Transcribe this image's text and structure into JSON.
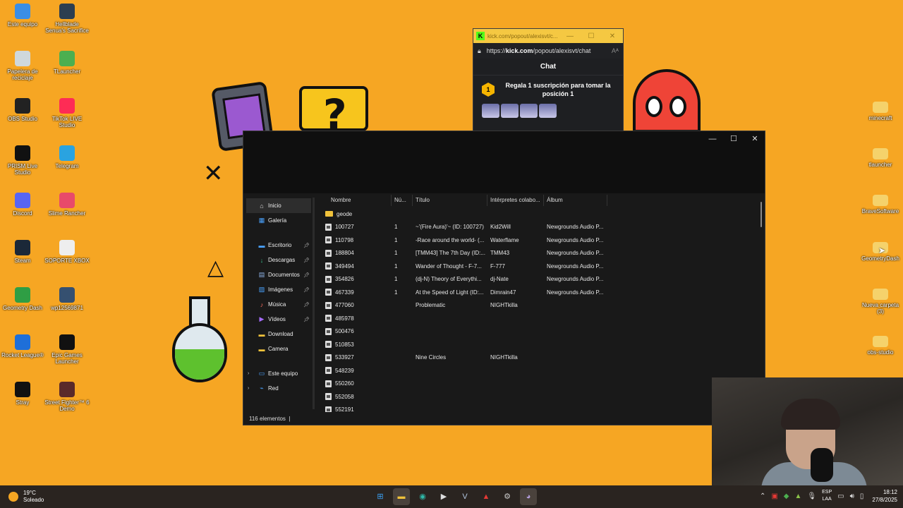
{
  "desktop": {
    "left_icons": [
      {
        "label": "Este equipo",
        "icon": "computer-icon",
        "color": "#3a8ee6"
      },
      {
        "label": "Hellblade Senua's Sacrifice",
        "icon": "game-icon",
        "color": "#2c3e50"
      },
      {
        "label": "Papelera de reciclaje",
        "icon": "recycle-bin-icon",
        "color": "#cfd8dc"
      },
      {
        "label": "TLauncher",
        "icon": "minecraft-icon",
        "color": "#4caf50"
      },
      {
        "label": "OBS Studio",
        "icon": "obs-icon",
        "color": "#222"
      },
      {
        "label": "TikTok LIVE Studio",
        "icon": "tiktok-icon",
        "color": "#fe2c55"
      },
      {
        "label": "PRISM Live Studio",
        "icon": "prism-icon",
        "color": "#111"
      },
      {
        "label": "Telegram",
        "icon": "telegram-icon",
        "color": "#2aa3e0"
      },
      {
        "label": "Discord",
        "icon": "discord-icon",
        "color": "#5865f2"
      },
      {
        "label": "Slime Rancher",
        "icon": "slime-icon",
        "color": "#e84a6a"
      },
      {
        "label": "Steam",
        "icon": "steam-icon",
        "color": "#1b2838"
      },
      {
        "label": "SOPORTE XBOX",
        "icon": "file-icon",
        "color": "#eeeeee"
      },
      {
        "label": "Geometry Dash",
        "icon": "geometry-dash-icon",
        "color": "#2f9e44"
      },
      {
        "label": "wp12569871",
        "icon": "image-icon",
        "color": "#355070"
      },
      {
        "label": "Rocket League®",
        "icon": "rocket-league-icon",
        "color": "#1e6fd9"
      },
      {
        "label": "Epic Games Launcher",
        "icon": "epic-icon",
        "color": "#111"
      },
      {
        "label": "Stray",
        "icon": "stray-icon",
        "color": "#111"
      },
      {
        "label": "Street Fighter™ 6 Demo",
        "icon": "street-fighter-icon",
        "color": "#5a2a2a"
      }
    ],
    "right_icons": [
      {
        "label": "minecraft",
        "icon": "folder-icon"
      },
      {
        "label": "tlauncher",
        "icon": "folder-icon"
      },
      {
        "label": "BraveSoftware",
        "icon": "folder-icon"
      },
      {
        "label": "GeometryDash",
        "icon": "folder-icon"
      },
      {
        "label": "Nueva carpeta (3)",
        "icon": "folder-icon"
      },
      {
        "label": "obs-studio",
        "icon": "folder-icon"
      }
    ]
  },
  "kick": {
    "tab_title": "kick.com/popout/alexisvt/c...",
    "url_prefix": "https://",
    "url_host": "kick.com",
    "url_path": "/popout/alexisvt/chat",
    "chat_title": "Chat",
    "banner_badge": "1",
    "banner_text": "Regala 1 suscripción para tomar la posición 1",
    "accent": "#53fc18"
  },
  "explorer": {
    "nav": [
      {
        "label": "Inicio",
        "icon": "home-icon",
        "selected": true,
        "pinned": false
      },
      {
        "label": "Galería",
        "icon": "gallery-icon",
        "selected": false,
        "pinned": false
      },
      {
        "label": "Escritorio",
        "icon": "desktop-icon",
        "selected": false,
        "pinned": true
      },
      {
        "label": "Descargas",
        "icon": "download-icon",
        "selected": false,
        "pinned": true
      },
      {
        "label": "Documentos",
        "icon": "documents-icon",
        "selected": false,
        "pinned": true
      },
      {
        "label": "Imágenes",
        "icon": "images-icon",
        "selected": false,
        "pinned": true
      },
      {
        "label": "Música",
        "icon": "music-icon",
        "selected": false,
        "pinned": true
      },
      {
        "label": "Vídeos",
        "icon": "videos-icon",
        "selected": false,
        "pinned": true
      },
      {
        "label": "Download",
        "icon": "folder-icon",
        "selected": false,
        "pinned": false
      },
      {
        "label": "Camera",
        "icon": "folder-icon",
        "selected": false,
        "pinned": false
      },
      {
        "label": "Este equipo",
        "icon": "computer-icon",
        "selected": false,
        "pinned": false
      },
      {
        "label": "Red",
        "icon": "network-icon",
        "selected": false,
        "pinned": false
      }
    ],
    "columns": [
      "Nombre",
      "Nú...",
      "Título",
      "Intérpretes colabo...",
      "Álbum"
    ],
    "rows": [
      {
        "name": "geode",
        "type": "folder",
        "num": "",
        "title": "",
        "artist": "",
        "album": ""
      },
      {
        "name": "100727",
        "type": "file",
        "num": "1",
        "title": "~'(Fire Aura)'~ (ID: 100727)",
        "artist": "Kid2Will",
        "album": "Newgrounds Audio P..."
      },
      {
        "name": "110798",
        "type": "file",
        "num": "1",
        "title": "-Race around the world- (...",
        "artist": "Waterflame",
        "album": "Newgrounds Audio P..."
      },
      {
        "name": "188804",
        "type": "file",
        "num": "1",
        "title": "[TMM43] The 7th Day (ID:...",
        "artist": "TMM43",
        "album": "Newgrounds Audio P..."
      },
      {
        "name": "349494",
        "type": "file",
        "num": "1",
        "title": "Wander of Thought - F-7...",
        "artist": "F-777",
        "album": "Newgrounds Audio P..."
      },
      {
        "name": "354826",
        "type": "file",
        "num": "1",
        "title": "(dj-N) Theory of Everythi...",
        "artist": "dj-Nate",
        "album": "Newgrounds Audio P..."
      },
      {
        "name": "467339",
        "type": "file",
        "num": "1",
        "title": "At the Speed of Light (ID:...",
        "artist": "Dimrain47",
        "album": "Newgrounds Audio P..."
      },
      {
        "name": "477060",
        "type": "file",
        "num": "",
        "title": "Problematic",
        "artist": "NIGHTkilla",
        "album": ""
      },
      {
        "name": "485978",
        "type": "file",
        "num": "",
        "title": "",
        "artist": "",
        "album": ""
      },
      {
        "name": "500476",
        "type": "file",
        "num": "",
        "title": "",
        "artist": "",
        "album": ""
      },
      {
        "name": "510853",
        "type": "file",
        "num": "",
        "title": "",
        "artist": "",
        "album": ""
      },
      {
        "name": "533927",
        "type": "file",
        "num": "",
        "title": "Nine Circles",
        "artist": "NIGHTkilla",
        "album": ""
      },
      {
        "name": "548239",
        "type": "file",
        "num": "",
        "title": "",
        "artist": "",
        "album": ""
      },
      {
        "name": "550260",
        "type": "file",
        "num": "",
        "title": "",
        "artist": "",
        "album": ""
      },
      {
        "name": "552058",
        "type": "file",
        "num": "",
        "title": "",
        "artist": "",
        "album": ""
      },
      {
        "name": "552191",
        "type": "file",
        "num": "",
        "title": "",
        "artist": "",
        "album": ""
      }
    ],
    "status": "116 elementos"
  },
  "taskbar": {
    "weather_temp": "19°C",
    "weather_desc": "Soleado",
    "apps": [
      {
        "icon": "start-icon",
        "glyph": "⊞",
        "color": "#3aa0f3",
        "active": false
      },
      {
        "icon": "file-explorer-icon",
        "glyph": "▬",
        "color": "#f0c23b",
        "active": true
      },
      {
        "icon": "edge-icon",
        "glyph": "◉",
        "color": "#2fb8a8",
        "active": false
      },
      {
        "icon": "media-player-icon",
        "glyph": "▶",
        "color": "#ddd",
        "active": false
      },
      {
        "icon": "vscode-icon",
        "glyph": "V",
        "color": "#b0c4de",
        "active": false
      },
      {
        "icon": "prism-icon",
        "glyph": "▲",
        "color": "#e53935",
        "active": false
      },
      {
        "icon": "steam-icon",
        "glyph": "⚙",
        "color": "#ccc",
        "active": false
      },
      {
        "icon": "discord-icon",
        "glyph": "◕",
        "color": "#b39ddb",
        "active": true
      }
    ],
    "lang_top": "ESP",
    "lang_bottom": "LAA",
    "time": "18:12",
    "date": "27/8/2025"
  }
}
